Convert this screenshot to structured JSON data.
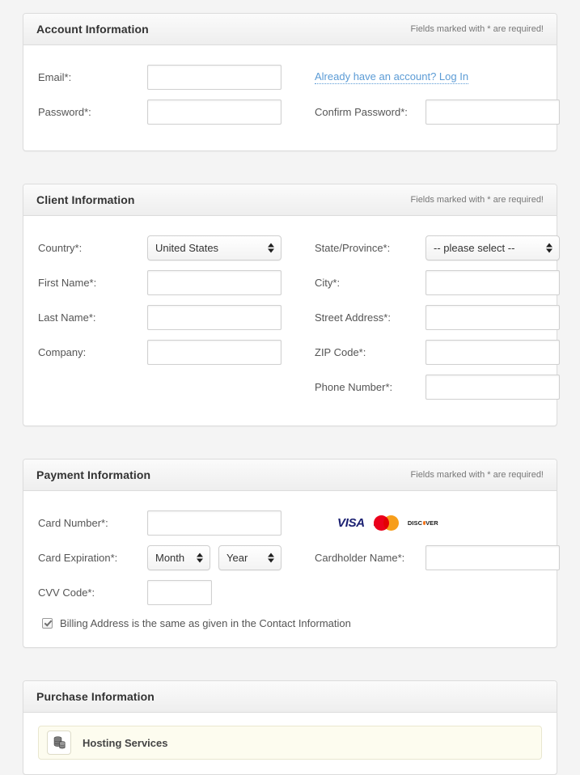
{
  "sections": {
    "account": {
      "title": "Account Information",
      "required_note": "Fields marked with * are required!",
      "fields": {
        "email_label": "Email*:",
        "password_label": "Password*:",
        "confirm_password_label": "Confirm Password*:",
        "email_value": "",
        "password_value": "",
        "confirm_password_value": ""
      },
      "login_link": "Already have an account? Log In"
    },
    "client": {
      "title": "Client Information",
      "required_note": "Fields marked with * are required!",
      "fields": {
        "country_label": "Country*:",
        "country_value": "United States",
        "state_label": "State/Province*:",
        "state_value": "-- please select --",
        "first_name_label": "First Name*:",
        "first_name_value": "",
        "city_label": "City*:",
        "city_value": "",
        "last_name_label": "Last Name*:",
        "last_name_value": "",
        "street_label": "Street Address*:",
        "street_value": "",
        "company_label": "Company:",
        "company_value": "",
        "zip_label": "ZIP Code*:",
        "zip_value": "",
        "phone_label": "Phone Number*:",
        "phone_value": ""
      }
    },
    "payment": {
      "title": "Payment Information",
      "required_note": "Fields marked with * are required!",
      "fields": {
        "card_number_label": "Card Number*:",
        "card_number_value": "",
        "card_expiration_label": "Card Expiration*:",
        "month_value": "Month",
        "year_value": "Year",
        "cardholder_label": "Cardholder Name*:",
        "cardholder_value": "",
        "cvv_label": "CVV Code*:",
        "cvv_value": ""
      },
      "cards": [
        {
          "name": "visa",
          "text": "VISA",
          "color": "#1a1f71"
        },
        {
          "name": "mastercard",
          "text": "mastercard",
          "color_left": "#eb001b",
          "color_right": "#f79e1b"
        },
        {
          "name": "discover",
          "text_before": "DISC",
          "text_after": "VER",
          "color": "#f47216"
        }
      ],
      "billing_checkbox": {
        "label": "Billing Address is the same as given in the Contact Information",
        "checked": true
      }
    },
    "purchase": {
      "title": "Purchase Information",
      "item": {
        "label": "Hosting Services",
        "icon": "database-stack-icon"
      }
    }
  },
  "theme": {
    "page_background": "#f4f4f4",
    "panel_background": "#ffffff",
    "panel_border": "#dcdcdc",
    "link_color": "#5b9bd5",
    "item_background": "#fdfcef"
  }
}
